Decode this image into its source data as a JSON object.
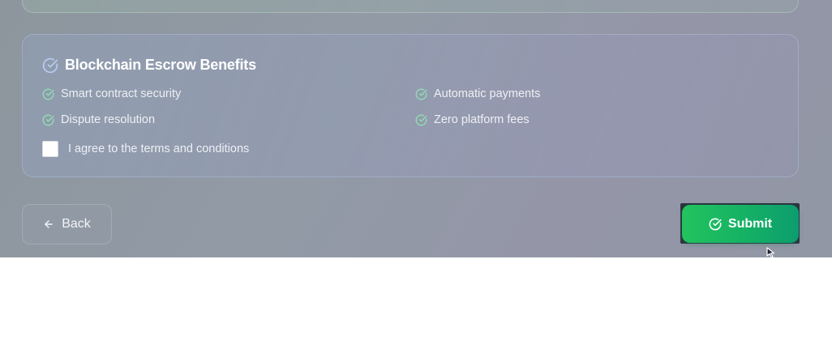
{
  "benefits": {
    "title": "Blockchain Escrow Benefits",
    "title_icon": "check-circle-icon",
    "items": [
      {
        "label": "Smart contract security",
        "icon": "check-circle-icon"
      },
      {
        "label": "Automatic payments",
        "icon": "check-circle-icon"
      },
      {
        "label": "Dispute resolution",
        "icon": "check-circle-icon"
      },
      {
        "label": "Zero platform fees",
        "icon": "check-circle-icon"
      }
    ]
  },
  "terms": {
    "label": "I agree to the terms and conditions",
    "checked": false
  },
  "actions": {
    "back_label": "Back",
    "back_icon": "arrow-left-icon",
    "submit_label": "Submit",
    "submit_icon": "check-circle-icon"
  },
  "colors": {
    "submit_gradient_start": "#22c35e",
    "submit_gradient_end": "#0c9d6e",
    "check_icon_green": "#8fe0b0",
    "title_icon_blue": "#b9cdf5"
  }
}
